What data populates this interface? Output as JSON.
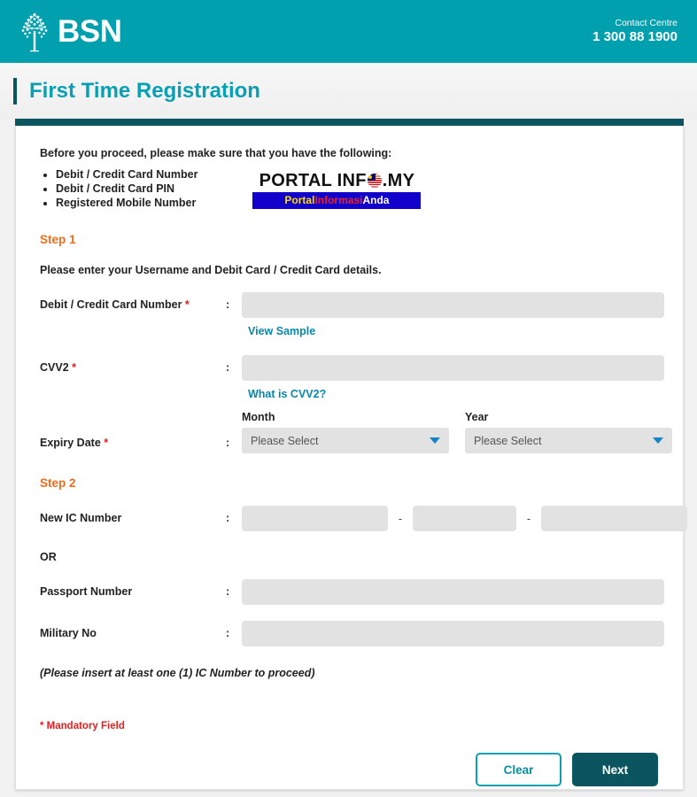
{
  "header": {
    "brand_name": "BSN",
    "logo_icon": "tree-logo-icon",
    "contact_label": "Contact Centre",
    "contact_number": "1 300 88 1900",
    "bg_color": "#00A0AF"
  },
  "page": {
    "title": "First Time Registration",
    "title_color": "#0aa0b4",
    "accent_bar_color": "#0b5560"
  },
  "intro": {
    "lead": "Before you proceed, please make sure that you have the following:",
    "requirements": [
      "Debit / Credit Card Number",
      "Debit / Credit Card PIN",
      "Registered Mobile Number"
    ]
  },
  "watermark": {
    "top_before": "PORTAL INF",
    "top_after": ".MY",
    "flag_icon": "malaysia-flag-icon",
    "tagline_1": "Portal",
    "tagline_2": "Informasi",
    "tagline_3": "Anda",
    "tagline_1_color": "#ffdd00",
    "tagline_2_color": "#ee2222",
    "tagline_3_color": "#ffffff",
    "band_color": "#1100cc"
  },
  "step1": {
    "heading": "Step 1",
    "description": "Please enter your Username and Debit Card / Credit Card details.",
    "card_number": {
      "label": "Debit / Credit Card Number",
      "mandatory": "*",
      "colon": ":",
      "value": "",
      "placeholder": "",
      "hint_link": "View Sample"
    },
    "cvv2": {
      "label": "CVV2",
      "mandatory": "*",
      "colon": ":",
      "value": "",
      "placeholder": "",
      "hint_link": "What is CVV2?"
    },
    "expiry": {
      "label": "Expiry Date",
      "mandatory": "*",
      "colon": ":",
      "month_caption": "Month",
      "month_value": "Please Select",
      "year_caption": "Year",
      "year_value": "Please Select",
      "caret_icon": "chevron-down-icon"
    }
  },
  "step2": {
    "heading": "Step 2",
    "ic": {
      "label": "New IC Number",
      "colon": ":",
      "part1": "",
      "part2": "",
      "part3": "",
      "separator": "-"
    },
    "or_text": "OR",
    "passport": {
      "label": "Passport Number",
      "colon": ":",
      "value": ""
    },
    "military": {
      "label": "Military No",
      "colon": ":",
      "value": ""
    },
    "note": "(Please insert at least one (1) IC Number to proceed)"
  },
  "footer": {
    "mandatory_note": "* Mandatory Field",
    "clear_label": "Clear",
    "next_label": "Next",
    "clear_color": "#0aa0b4",
    "next_color": "#0b5560"
  }
}
